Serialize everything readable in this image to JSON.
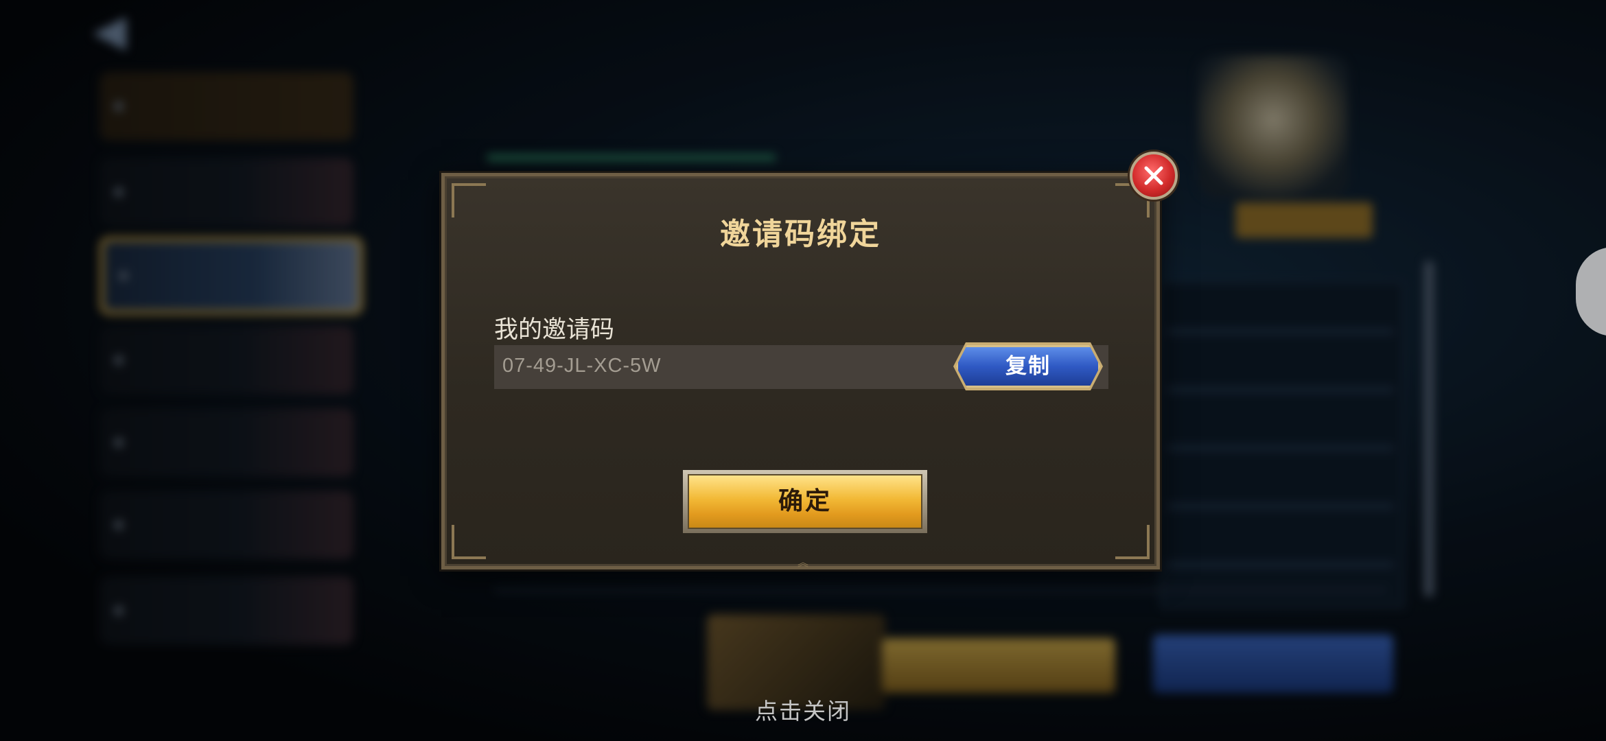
{
  "dialog": {
    "title": "邀请码绑定",
    "field_label": "我的邀请码",
    "invite_code": "07-49-JL-XC-5W",
    "copy_label": "复制",
    "confirm_label": "确定"
  },
  "tap_to_close": "点击关闭",
  "icons": {
    "close": "close-x-icon",
    "back": "back-arrow-icon"
  },
  "colors": {
    "title_gold": "#f0d59a",
    "copy_blue": "#2f59c4",
    "confirm_gold": "#f2b936",
    "close_red": "#d22b2b"
  }
}
